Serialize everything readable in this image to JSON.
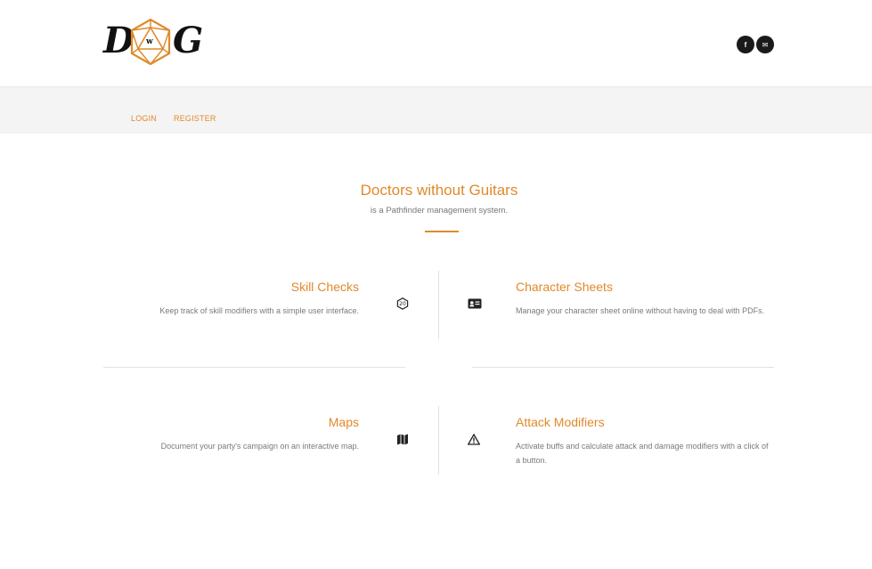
{
  "header": {
    "logo": {
      "letter_left": "D",
      "letter_center": "w",
      "letter_right": "G"
    },
    "social": [
      {
        "name": "facebook",
        "glyph": "f"
      },
      {
        "name": "email",
        "glyph": "✉"
      }
    ]
  },
  "nav": {
    "login": "LOGIN",
    "register": "REGISTER"
  },
  "hero": {
    "title": "Doctors without Guitars",
    "subtitle": "is a Pathfinder management system."
  },
  "features": [
    {
      "title": "Skill Checks",
      "description": "Keep track of skill modifiers with a simple user interface.",
      "icon": "d20-icon",
      "icon_text": "20"
    },
    {
      "title": "Character Sheets",
      "description": "Manage your character sheet online without having to deal with PDFs.",
      "icon": "id-card-icon"
    },
    {
      "title": "Maps",
      "description": "Document your party's campaign on an interactive map.",
      "icon": "map-icon"
    },
    {
      "title": "Attack Modifiers",
      "description": "Activate buffs and calculate attack and damage modifiers with a click of a button.",
      "icon": "warning-icon"
    }
  ],
  "colors": {
    "accent": "#e08a2a",
    "nav_bg": "#f4f4f4",
    "text": "#777777"
  }
}
